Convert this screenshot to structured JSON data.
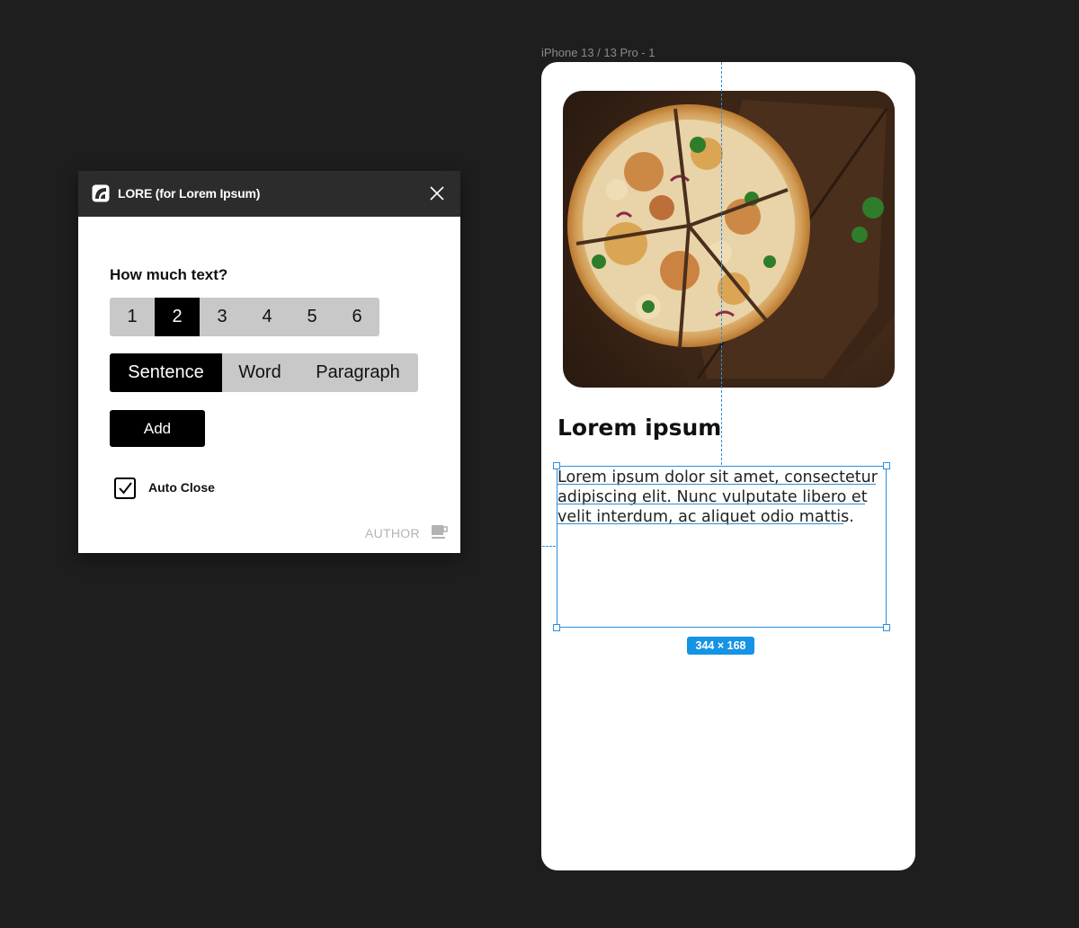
{
  "plugin": {
    "title": "LORE (for Lorem Ipsum)",
    "question": "How much text?",
    "amounts": [
      "1",
      "2",
      "3",
      "4",
      "5",
      "6"
    ],
    "selected_amount": "2",
    "units": [
      "Sentence",
      "Word",
      "Paragraph"
    ],
    "selected_unit": "Sentence",
    "add_label": "Add",
    "auto_close_label": "Auto Close",
    "auto_close_checked": true,
    "author_label": "AUTHOR"
  },
  "frame": {
    "label": "iPhone 13 / 13 Pro - 1",
    "heading": "Lorem ipsum",
    "body_text": "Lorem ipsum dolor sit amet, consectetur adipiscing elit. Nunc vulputate libero et velit interdum, ac aliquet odio mattis.",
    "selection_size": "344 × 168",
    "image_subject": "pizza on wooden board"
  },
  "colors": {
    "canvas": "#1e1e1e",
    "plugin_header": "#2c2c2c",
    "selection": "#2b8fdd",
    "size_badge": "#1593e5",
    "segment_bg": "#c8c8c8",
    "active": "#000000"
  },
  "icons": {
    "plugin_logo": "lore-logo-icon",
    "close": "close-icon",
    "checkbox": "checkmark-icon",
    "author": "coffee-cup-icon"
  }
}
